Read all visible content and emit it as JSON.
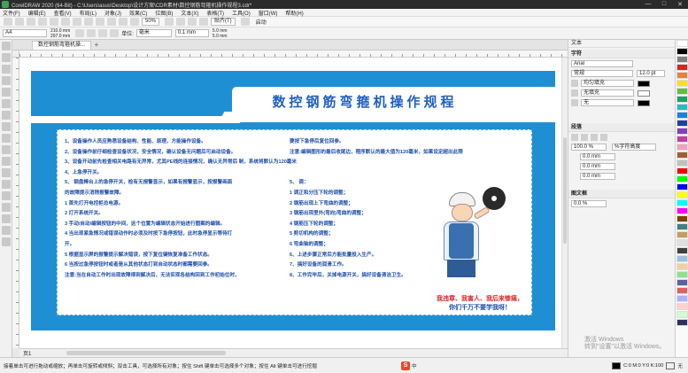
{
  "window": {
    "title": "CorelDRAW 2020 (64-Bit) - C:\\Users\\asus\\Desktop\\设计方案\\CDR素材\\数控钢筋弯箍机操作规程3.cdr*",
    "controls": [
      "—",
      "□",
      "✕"
    ]
  },
  "menu": [
    "文件(F)",
    "编辑(E)",
    "查看(V)",
    "布局(L)",
    "对象(J)",
    "效果(C)",
    "位图(B)",
    "文本(X)",
    "表格(T)",
    "工具(O)",
    "窗口(W)",
    "帮助(H)"
  ],
  "standard_toolbar": {
    "zoom": "50%",
    "snap": "贴齐(T)",
    "launch": "启动"
  },
  "property_bar": {
    "page_size": "A4",
    "width": "210.0 mm",
    "height": "297.0 mm",
    "units_label": "单位:",
    "units": "毫米",
    "nudge": "0.1 mm",
    "dup_distance": "5.0 mm",
    "dup_x": "5.0 mm",
    "dup_y": "5.0 mm"
  },
  "document_tab": "数控钢筋弯箍机操...",
  "board": {
    "title": "数控钢筋弯箍机操作规程",
    "left_lines": [
      "1、设备操作人员应熟悉设备结构、性能、原理，方能操作设备。",
      "2、设备操作前仔细检查设备状况，安全情况，确认设备无问题后可启动设备。",
      "3、设备开动前先检查相关电路有无异常，尤其PE线的连接情况，确认无异常后 制，系统将默认为120毫米，开机后必须回参！",
      "4、上急停开关。",
      "5、     钢盘棒台上的急停开关，检有无报警显示，如果有报警显示，按报警画面",
      "的故障提示消除报警故障。",
      "1 首先打开电控柜总电源。",
      "2 打开系统开关。",
      "3 手动/自动/编辑按钮的中间，这个位置为编辑状态开始进行图案的编辑。",
      "4 当出现紧急情况或错误动作时必须及时按下急停按钮，此时急停显示等待打",
      "开。",
      "5 根据显示屏的报警提示解决错误，按下复位键恢复准备工作状态。",
      "6 当按过急停按钮时或者是从其他状态打到自动状态时都需要回参。",
      "注意:当在自动工作时出现故障得到解决后，无法实现各结构回到工作初始位时，"
    ],
    "right_lines": [
      "要按下急停后复位回参。",
      "注意:编辑图形的最后收尾边，程序默认的最大值为120毫米，如果设定超出此限",
      "",
      "",
      "5、      调：",
      "1 调正和分压下轮的调整；",
      "2 钢筋出现上下弯曲的调整；",
      "3 钢筋出现里外(弯向)弯曲的调整；",
      "4 钢筋压下轮的调整；",
      "5 剪切机构的调整；",
      "6 弯曲轴的调整；",
      "6、上述步骤正常后方能批量投入生产。",
      "7、搞好设备的润滑工作。",
      "8、工作完毕后，关掉电源开关，搞好设备清洁卫生。"
    ],
    "slogan_1": "我违章、我害人、我后来惨痛，",
    "slogan_2": "你们千万不要学我呀！"
  },
  "page_nav": "页1",
  "dock": {
    "panel_title": "文本",
    "char_section": "字符",
    "font": "Arial",
    "style": "常规",
    "size": "12.0 pt",
    "fill_label": "均匀填充",
    "bg_label": "无填充",
    "outline_label": "无",
    "para_section": "段落",
    "para_val1": "100.0 %",
    "spacing": "%字符高度",
    "indent1": "0.0 mm",
    "indent2": "0.0 mm",
    "indent3": "0.0 mm",
    "frame_section": "图文框",
    "frame_val": "0.0 %"
  },
  "palette_colors": [
    "#ffffff",
    "#000000",
    "#7f7f7f",
    "#e02020",
    "#f08030",
    "#f7e020",
    "#60c040",
    "#20a060",
    "#20c0c0",
    "#2080e0",
    "#2040a0",
    "#8040c0",
    "#c040a0",
    "#f0a0c0",
    "#a06030",
    "#c0c0c0",
    "#ff0000",
    "#00ff00",
    "#0000ff",
    "#ffff00",
    "#00ffff",
    "#ff00ff",
    "#804000",
    "#408080",
    "#c0a060",
    "#e0e0e0",
    "#404040",
    "#a0c0e0",
    "#f0d0a0",
    "#90e090",
    "#6060a0",
    "#e06060",
    "#b0b0ff",
    "#ffd0d0",
    "#d0ffd0",
    "#303060"
  ],
  "status": {
    "hint": "接着单击可进行拖动或缩放；再单击可旋转或倾斜；双击工具，可选择所有对象；按住 Shift 键单击可选择多个对象；按住 Alt 键单击可进行挖掘",
    "ime": "S 中 ·, 🎤 ⌨ 👕 ⋯",
    "fill_status": "C:0 M:0 Y:0 K:100",
    "outline_status": "无"
  },
  "watermark": "激活 Windows\n转到\"设置\"以激活 Windows。"
}
